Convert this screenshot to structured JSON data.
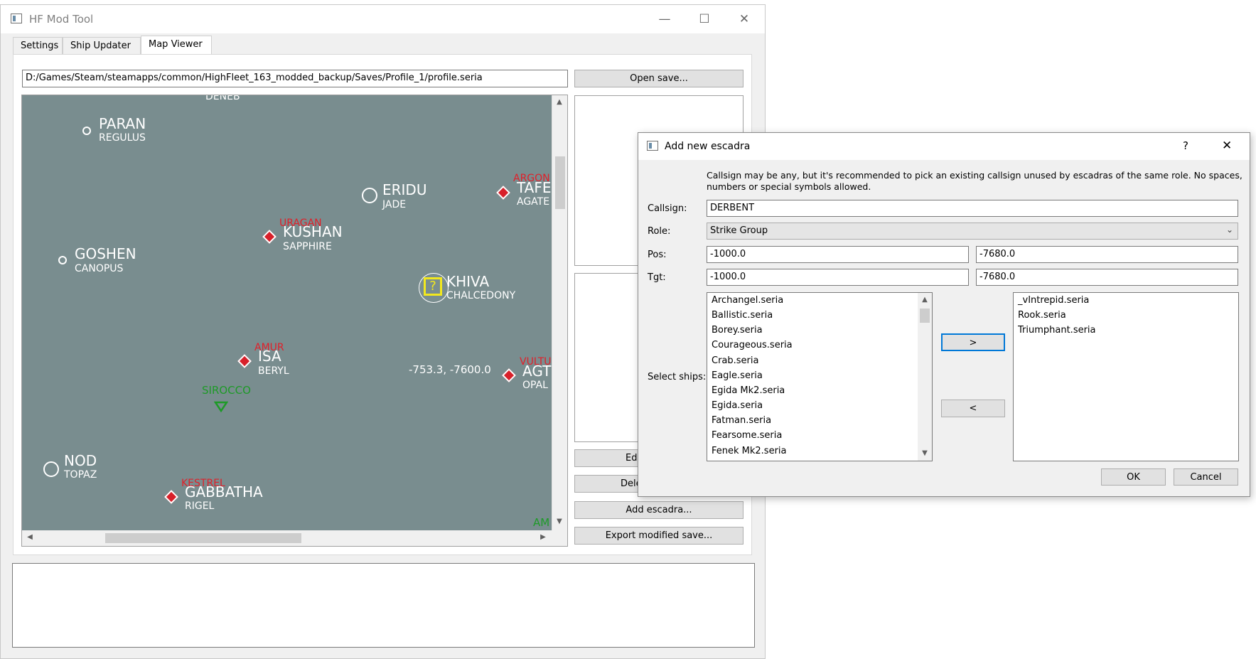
{
  "window": {
    "title": "HF Mod Tool",
    "minimize": "—",
    "maximize": "☐",
    "close": "✕"
  },
  "tabs": [
    {
      "label": "Settings"
    },
    {
      "label": "Ship Updater"
    },
    {
      "label": "Map Viewer"
    }
  ],
  "path": {
    "value": "D:/Games/Steam/steamapps/common/HighFleet_163_modded_backup/Saves/Profile_1/profile.seria"
  },
  "buttons": {
    "open_save": "Open save...",
    "edit": "Edit",
    "delete": "Dele",
    "add_escadra": "Add escadra...",
    "export": "Export modified save..."
  },
  "map": {
    "cities": [
      {
        "name": "DENEB",
        "sub": ""
      },
      {
        "name": "PARAN",
        "sub": "REGULUS"
      },
      {
        "name": "ERIDU",
        "sub": "JADE"
      },
      {
        "name": "TAFE",
        "sub": "AGATE"
      },
      {
        "name": "KUSHAN",
        "sub": "SAPPHIRE"
      },
      {
        "name": "GOSHEN",
        "sub": "CANOPUS"
      },
      {
        "name": "KHIVA",
        "sub": "CHALCEDONY"
      },
      {
        "name": "ISA",
        "sub": "BERYL"
      },
      {
        "name": "AGT",
        "sub": "OPAL"
      },
      {
        "name": "NOD",
        "sub": "TOPAZ"
      },
      {
        "name": "GABBATHA",
        "sub": "RIGEL"
      }
    ],
    "escadras_red": [
      "ARGON",
      "URAGAN",
      "AMUR",
      "VULTU",
      "KESTREL"
    ],
    "escadras_green": [
      "SIROCCO",
      "AM"
    ],
    "selected_marker": "?",
    "cursor_coords": "-753.3, -7600.0"
  },
  "dialog": {
    "title": "Add new escadra",
    "help": "?",
    "close": "✕",
    "hint_line1": "Callsign may be any, but it's recommended to pick an existing callsign unused by escadras of the same role. No spaces,",
    "hint_line2": "numbers or special symbols allowed.",
    "callsign_label": "Callsign:",
    "callsign_value": "DERBENT",
    "role_label": "Role:",
    "role_value": "Strike Group",
    "pos_label": "Pos:",
    "pos_x": "-1000.0",
    "pos_y": "-7680.0",
    "tgt_label": "Tgt:",
    "tgt_x": "-1000.0",
    "tgt_y": "-7680.0",
    "select_ships_label": "Select ships:",
    "available_ships": [
      "Archangel.seria",
      "Ballistic.seria",
      "Borey.seria",
      "Courageous.seria",
      "Crab.seria",
      "Eagle.seria",
      "Egida Mk2.seria",
      "Egida.seria",
      "Fatman.seria",
      "Fearsome.seria",
      "Fenek Mk2.seria"
    ],
    "selected_ships": [
      "_vIntrepid.seria",
      "Rook.seria",
      "Triumphant.seria"
    ],
    "add_button": ">",
    "remove_button": "<",
    "ok_button": "OK",
    "cancel_button": "Cancel"
  }
}
